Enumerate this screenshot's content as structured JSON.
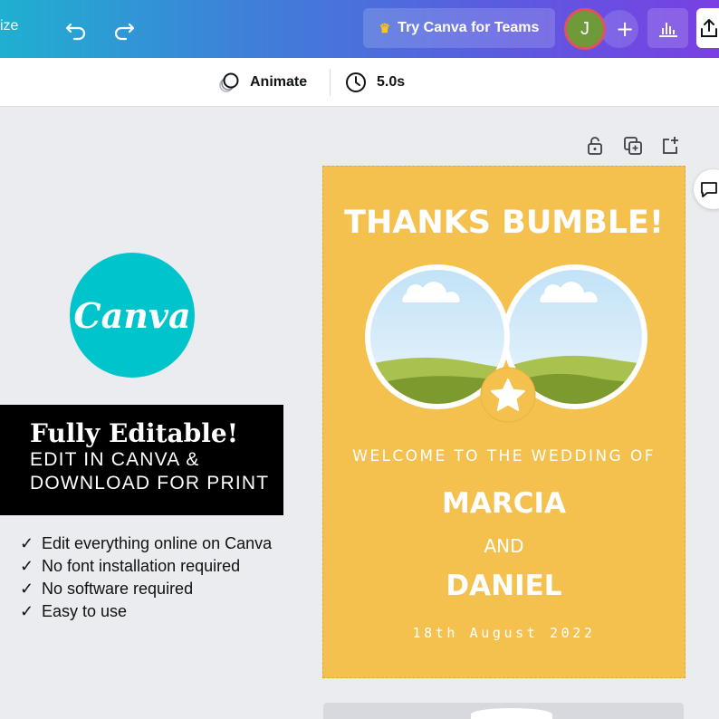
{
  "topbar": {
    "resize_label": "ize",
    "teams_label": "Try Canva for Teams",
    "avatar_initial": "J",
    "add_label": "+",
    "colors": {
      "gradient_start": "#1fb0d0",
      "gradient_end": "#7a3fe3",
      "avatar": "#6e9a3a",
      "crown": "#ffc21a"
    },
    "icons": [
      "undo-icon",
      "redo-icon",
      "crown-icon",
      "bar-chart-icon",
      "share-icon"
    ]
  },
  "toolbar": {
    "animate_label": "Animate",
    "duration_label": "5.0s",
    "icons": [
      "animate-icon",
      "clock-icon"
    ]
  },
  "promo": {
    "logo_text": "Canva",
    "title": "Fully Editable!",
    "line1": "EDIT IN CANVA &",
    "line2": "DOWNLOAD FOR PRINT",
    "features": [
      "Edit everything online on Canva",
      "No font installation required",
      "No software required",
      "Easy to use"
    ],
    "colors": {
      "logo": "#00c4cc",
      "box": "#000000"
    }
  },
  "page_controls": {
    "icons": [
      "lock-icon",
      "duplicate-icon",
      "add-page-icon",
      "comment-icon"
    ]
  },
  "design": {
    "title": "THANKS BUMBLE!",
    "welcome": "WELCOME TO THE WEDDING OF",
    "name1": "MARCIA",
    "and": "AND",
    "name2": "DANIEL",
    "date": "18th August 2022",
    "colors": {
      "background": "#f4c14f",
      "star_badge": "#f4c14f",
      "hills": "#7d9a2f",
      "sky": "#d7eefa"
    }
  }
}
